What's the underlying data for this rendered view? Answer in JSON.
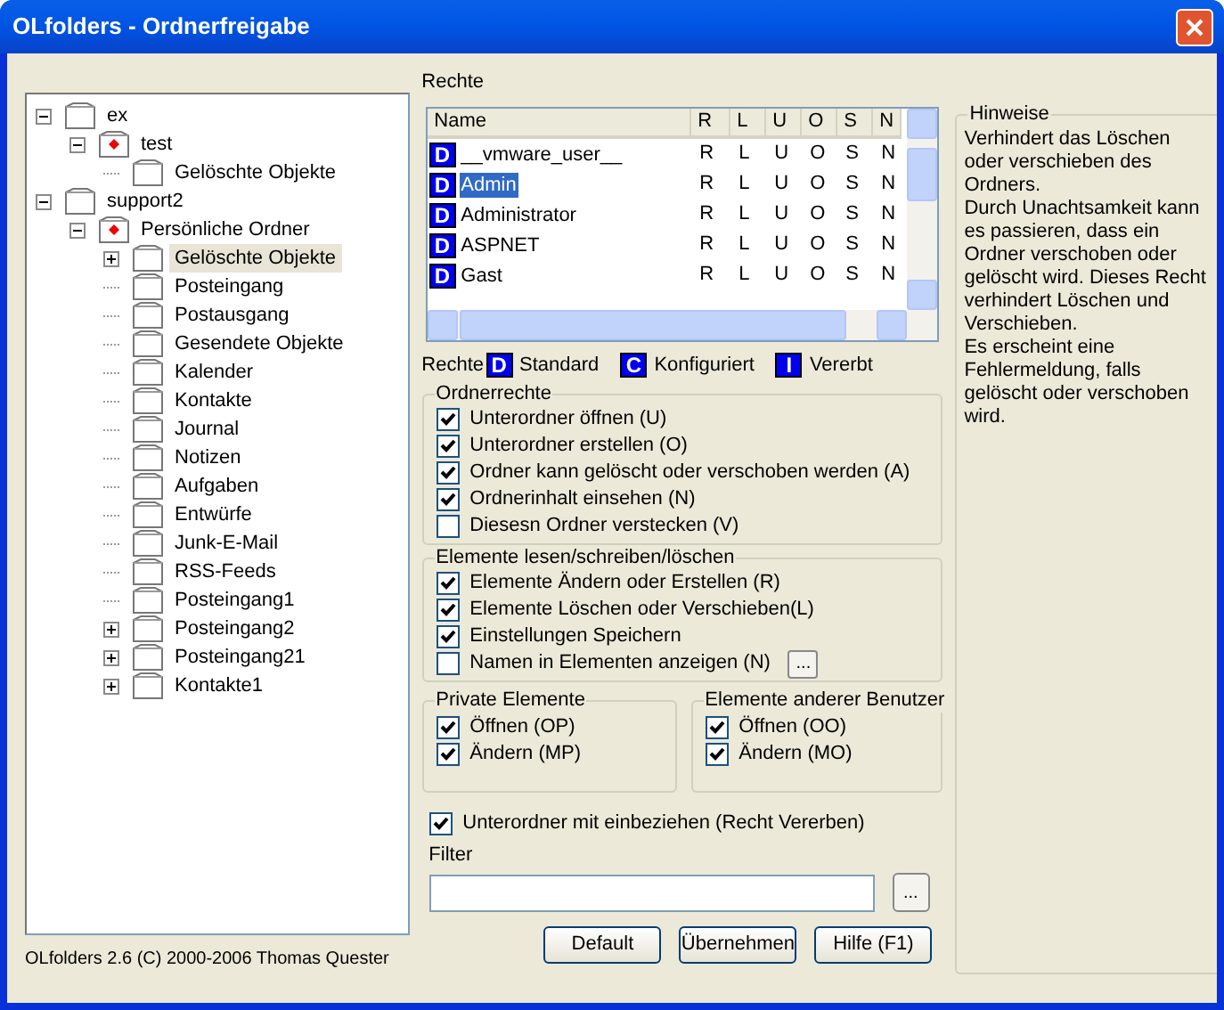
{
  "window": {
    "title": "OLfolders - Ordnerfreigabe"
  },
  "tree": [
    {
      "label": "ex",
      "kind": "mailbox",
      "expanded": true,
      "selected": false,
      "children": [
        {
          "label": "test",
          "kind": "store",
          "expanded": true,
          "selected": false,
          "children": [
            {
              "label": "Gelöschte Objekte",
              "kind": "folder",
              "selected": false
            }
          ]
        }
      ]
    },
    {
      "label": "support2",
      "kind": "mailbox",
      "expanded": true,
      "selected": false,
      "children": [
        {
          "label": "Persönliche Ordner",
          "kind": "store",
          "expanded": true,
          "selected": false,
          "children": [
            {
              "label": "Gelöschte Objekte",
              "kind": "folder",
              "expanded": false,
              "selected": true
            },
            {
              "label": "Posteingang",
              "kind": "folder",
              "selected": false
            },
            {
              "label": "Postausgang",
              "kind": "folder",
              "selected": false
            },
            {
              "label": "Gesendete Objekte",
              "kind": "folder",
              "selected": false
            },
            {
              "label": "Kalender",
              "kind": "folder",
              "selected": false
            },
            {
              "label": "Kontakte",
              "kind": "folder",
              "selected": false
            },
            {
              "label": "Journal",
              "kind": "folder",
              "selected": false
            },
            {
              "label": "Notizen",
              "kind": "folder",
              "selected": false
            },
            {
              "label": "Aufgaben",
              "kind": "folder",
              "selected": false
            },
            {
              "label": "Entwürfe",
              "kind": "folder",
              "selected": false
            },
            {
              "label": "Junk-E-Mail",
              "kind": "folder",
              "selected": false
            },
            {
              "label": "RSS-Feeds",
              "kind": "folder",
              "selected": false
            },
            {
              "label": "Posteingang1",
              "kind": "folder",
              "selected": false
            },
            {
              "label": "Posteingang2",
              "kind": "folder",
              "expanded": false,
              "selected": false
            },
            {
              "label": "Posteingang21",
              "kind": "folder",
              "expanded": false,
              "selected": false
            },
            {
              "label": "Kontakte1",
              "kind": "folder",
              "expanded": false,
              "selected": false
            }
          ]
        }
      ]
    }
  ],
  "footer": "OLfolders 2.6 (C) 2000-2006 Thomas Quester",
  "rights": {
    "label": "Rechte",
    "columns": [
      "Name",
      "R",
      "L",
      "U",
      "O",
      "S",
      "N"
    ],
    "rows": [
      {
        "badge": "D",
        "cells": [
          "__vmware_user__",
          "R",
          "L",
          "U",
          "O",
          "S",
          "N"
        ],
        "selected": false
      },
      {
        "badge": "D",
        "cells": [
          "Admin",
          "R",
          "L",
          "U",
          "O",
          "S",
          "N"
        ],
        "selected": true
      },
      {
        "badge": "D",
        "cells": [
          "Administrator",
          "R",
          "L",
          "U",
          "O",
          "S",
          "N"
        ],
        "selected": false
      },
      {
        "badge": "D",
        "cells": [
          "ASPNET",
          "R",
          "L",
          "U",
          "O",
          "S",
          "N"
        ],
        "selected": false
      },
      {
        "badge": "D",
        "cells": [
          "Gast",
          "R",
          "L",
          "U",
          "O",
          "S",
          "N"
        ],
        "selected": false
      }
    ]
  },
  "legend": {
    "label": "Rechte",
    "items": [
      {
        "badge": "D",
        "text": "Standard"
      },
      {
        "badge": "C",
        "text": "Konfiguriert"
      },
      {
        "badge": "I",
        "text": "Vererbt"
      }
    ]
  },
  "groups": [
    {
      "title": "Ordnerrechte",
      "items": [
        {
          "label": "Unterordner öffnen (U)",
          "checked": true
        },
        {
          "label": "Unterordner erstellen (O)",
          "checked": true
        },
        {
          "label": "Ordner kann gelöscht oder verschoben werden (A)",
          "checked": true
        },
        {
          "label": "Ordnerinhalt einsehen (N)",
          "checked": true
        },
        {
          "label": "Diesesn Ordner verstecken (V)",
          "checked": false
        }
      ]
    },
    {
      "title": "Elemente lesen/schreiben/löschen",
      "items": [
        {
          "label": "Elemente Ändern oder Erstellen (R)",
          "checked": true
        },
        {
          "label": "Elemente Löschen oder Verschieben(L)",
          "checked": true
        },
        {
          "label": "Einstellungen Speichern",
          "checked": true
        },
        {
          "label": "Namen in Elementen anzeigen (N)",
          "checked": false,
          "button": "..."
        }
      ]
    }
  ],
  "subgroups": [
    {
      "title": "Private Elemente",
      "items": [
        {
          "label": "Öffnen (OP)",
          "checked": true
        },
        {
          "label": "Ändern (MP)",
          "checked": true
        }
      ]
    },
    {
      "title": "Elemente anderer Benutzer",
      "items": [
        {
          "label": "Öffnen (OO)",
          "checked": true
        },
        {
          "label": "Ändern (MO)",
          "checked": true
        }
      ]
    }
  ],
  "inherit": {
    "label": "Unterordner mit einbeziehen (Recht Vererben)",
    "checked": true
  },
  "filter": {
    "label": "Filter",
    "button": "..."
  },
  "buttons": [
    "Default",
    "Übernehmen",
    "Hilfe (F1)"
  ],
  "hints": {
    "title": "Hinweise",
    "paragraphs": [
      "Verhindert das Löschen oder verschieben des Ordners.",
      "Durch Unachtsamkeit kann es passieren, dass ein Ordner verschoben oder gelöscht wird. Dieses Recht verhindert Löschen und Verschieben.",
      "Es erscheint eine Fehlermeldung, falls gelöscht oder verschoben wird."
    ]
  }
}
